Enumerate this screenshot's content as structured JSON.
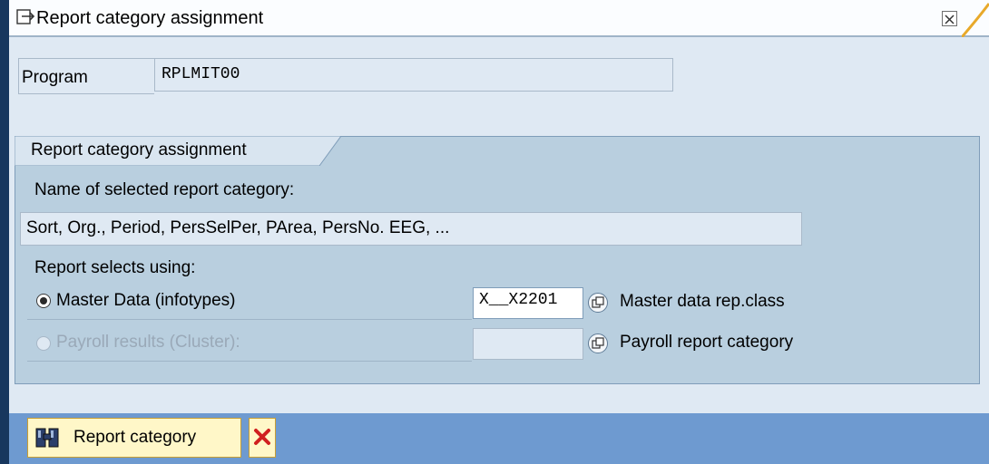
{
  "window": {
    "title": "Report category assignment"
  },
  "program": {
    "label": "Program",
    "value": "RPLMIT00"
  },
  "group": {
    "title": "Report category assignment",
    "name_label": "Name of selected report category:",
    "name_value": "Sort, Org., Period, PersSelPer, PArea, PersNo. EEG, ...",
    "selects_label": "Report selects using:",
    "options": [
      {
        "label": "Master Data (infotypes)",
        "selected": true,
        "enabled": true,
        "field_value": "X__X2201",
        "button_label": "Master data rep.class"
      },
      {
        "label": "Payroll results (Cluster):",
        "selected": false,
        "enabled": false,
        "field_value": "",
        "button_label": "Payroll report category"
      }
    ]
  },
  "toolbar": {
    "report_category_label": "Report category"
  },
  "colors": {
    "frame_dark": "#17375e",
    "toolbar_blue": "#6e9ad0",
    "group_bg": "#b9cfdf",
    "cancel_red": "#d02020"
  }
}
